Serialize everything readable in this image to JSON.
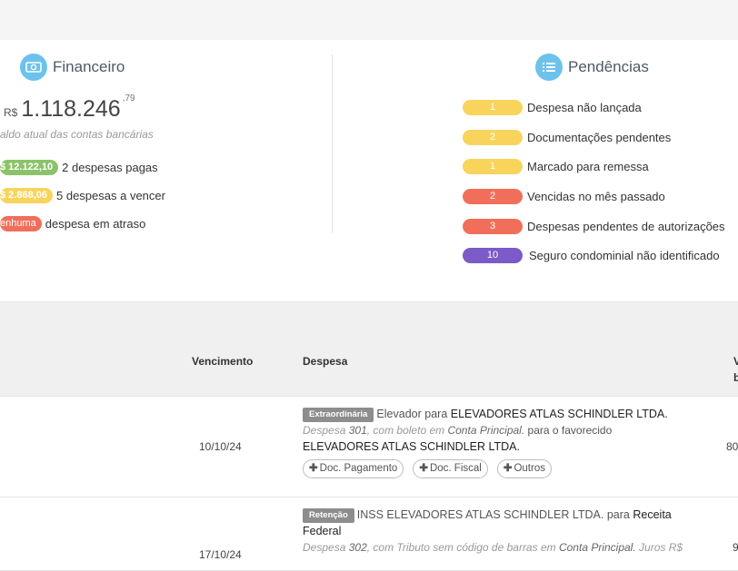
{
  "financeiro": {
    "title": "Financeiro",
    "icon": "money-icon",
    "currency": "R$",
    "balance_int": "1.118.246",
    "balance_cents": ",79",
    "balance_caption": "aldo atual das contas bancárias",
    "rows": [
      {
        "pill": "$ 12.122,10",
        "text": "2 despesas pagas",
        "color": "#8cc36a"
      },
      {
        "pill": "$ 2.868,06",
        "text": "5 despesas a vencer",
        "color": "#f8d45c"
      },
      {
        "pill": "enhuma",
        "text": "despesa em atraso",
        "color": "#f16f5a"
      }
    ]
  },
  "pendencias": {
    "title": "Pendências",
    "icon": "list-icon",
    "items": [
      {
        "count": "1",
        "label": "Despesa não lançada",
        "color": "#f8d45c"
      },
      {
        "count": "2",
        "label": "Documentações pendentes",
        "color": "#f8d45c"
      },
      {
        "count": "1",
        "label": "Marcado para remessa",
        "color": "#f8d45c"
      },
      {
        "count": "2",
        "label": "Vencidas no mês passado",
        "color": "#f16f5a"
      },
      {
        "count": "3",
        "label": "Despesas pendentes de autorizações",
        "color": "#f16f5a"
      },
      {
        "count": "10",
        "label": "Seguro condominial não identificado",
        "color": "#7c5ac7"
      }
    ]
  },
  "table": {
    "headers": {
      "vencimento": "Vencimento",
      "despesa": "Despesa",
      "valor_partial_1": "V",
      "valor_partial_2": "b"
    },
    "rows": [
      {
        "date": "10/10/24",
        "tag": "Extraordinária",
        "title_a": "Elevador",
        "title_b": "para",
        "title_c": "ELEVADORES ATLAS SCHINDLER LTDA.",
        "meta_a": "Despesa",
        "meta_num": "301",
        "meta_b": ", com boleto em",
        "meta_acct": "Conta Principal.",
        "meta_c": "para o favorecido",
        "meta_fav": "ELEVADORES ATLAS SCHINDLER LTDA.",
        "value_partial": "80",
        "buttons": [
          "Doc. Pagamento",
          "Doc. Fiscal",
          "Outros"
        ]
      },
      {
        "date": "17/10/24",
        "tag": "Retenção",
        "title_a": "INSS ELEVADORES ATLAS SCHINDLER LTDA.",
        "title_b": "para",
        "title_c": "Receita",
        "title_d": "Federal",
        "meta_a": "Despesa",
        "meta_num": "302",
        "meta_b": ", com Tributo sem código de barras em",
        "meta_acct": "Conta Principal.",
        "meta_c": "Juros R$",
        "value_partial": "9"
      }
    ]
  }
}
